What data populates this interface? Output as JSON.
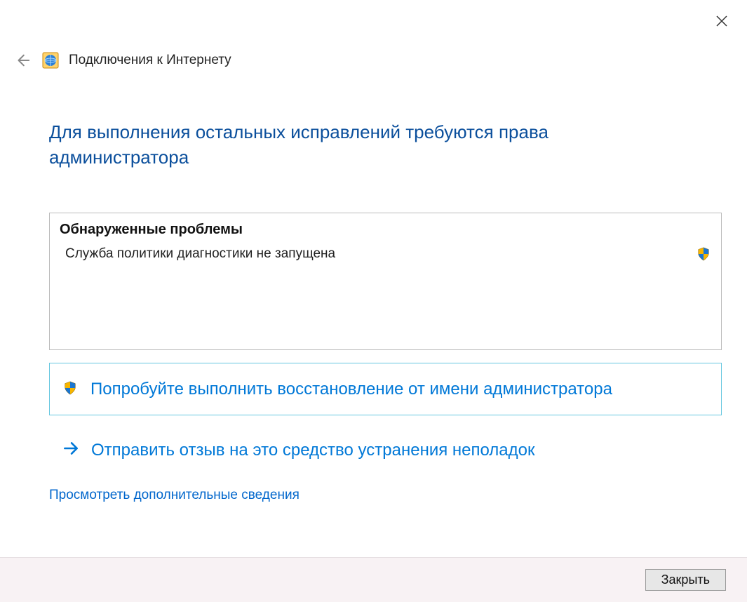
{
  "window": {
    "title": "Подключения к Интернету"
  },
  "heading": "Для выполнения остальных исправлений требуются права администратора",
  "problems": {
    "box_title": "Обнаруженные проблемы",
    "items": [
      {
        "text": "Служба политики диагностики не запущена"
      }
    ]
  },
  "actions": {
    "run_as_admin": "Попробуйте выполнить восстановление от имени администратора",
    "send_feedback": "Отправить отзыв на это средство устранения неполадок",
    "more_info": "Просмотреть дополнительные сведения"
  },
  "footer": {
    "close_label": "Закрыть"
  }
}
